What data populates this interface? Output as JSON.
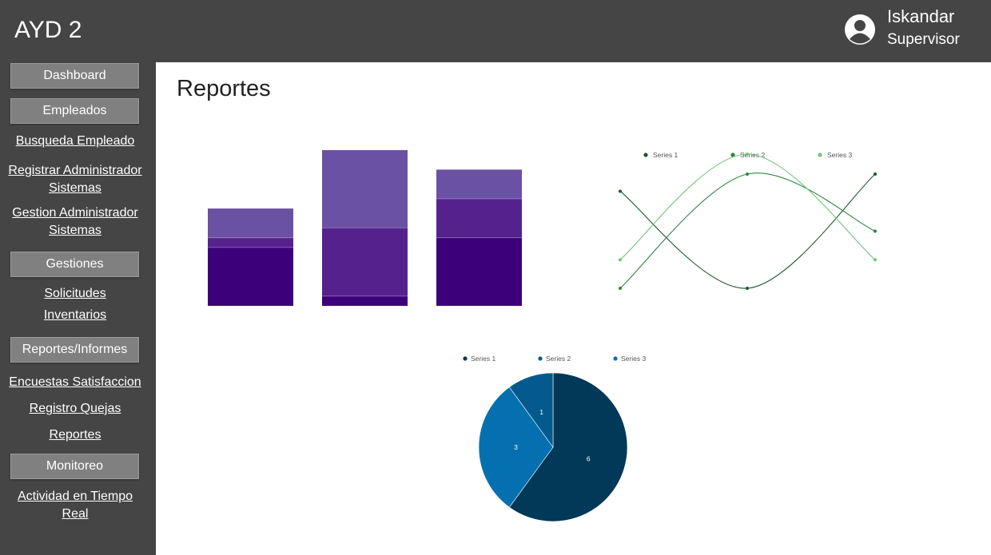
{
  "header": {
    "title": "AYD 2",
    "user_name": "Iskandar",
    "user_role": "Supervisor"
  },
  "sidebar": {
    "dashboard": "Dashboard",
    "empleados": "Empleados",
    "busqueda_empleado": "Busqueda Empleado",
    "registrar_admin_1": "Registrar Administrador",
    "registrar_admin_2": "Sistemas",
    "gestion_admin_1": "Gestion Administrador",
    "gestion_admin_2": "Sistemas",
    "gestiones": "Gestiones",
    "solicitudes": "Solicitudes",
    "inventarios": "Inventarios",
    "reportes_informes": "Reportes/Informes",
    "encuestas": "Encuestas Satisfaccion",
    "registro_quejas": "Registro Quejas",
    "reportes": "Reportes",
    "monitoreo": "Monitoreo",
    "actividad_1": "Actividad en Tiempo",
    "actividad_2": "Real"
  },
  "main": {
    "title": "Reportes"
  },
  "colors": {
    "header_bg": "#454545",
    "sidebar_btn": "#808080",
    "bar_series": [
      "#3d007b",
      "#55228d",
      "#6a51a3"
    ],
    "line_series": [
      "#1e5631",
      "#2e8540",
      "#74c476"
    ],
    "pie_series": [
      "#023858",
      "#045a8d",
      "#0570b0"
    ]
  },
  "chart_data": [
    {
      "type": "bar",
      "stacked": true,
      "categories": [
        "",
        "",
        ""
      ],
      "series": [
        {
          "values": [
            6,
            1,
            7
          ]
        },
        {
          "values": [
            1,
            7,
            4
          ]
        },
        {
          "values": [
            3,
            8,
            3
          ]
        }
      ],
      "ylim": [
        0,
        16
      ],
      "grid": false
    },
    {
      "type": "line",
      "curve": "smooth",
      "x": [
        1,
        2,
        3
      ],
      "series": [
        {
          "name": "Series 1",
          "values": [
            3.4,
            0,
            4
          ]
        },
        {
          "name": "Series 2",
          "values": [
            0,
            4,
            2
          ]
        },
        {
          "name": "Series 3",
          "values": [
            1,
            4.7,
            1
          ]
        }
      ],
      "ylim": [
        0,
        4.7
      ],
      "legend": "top",
      "grid": false
    },
    {
      "type": "pie",
      "labels": [
        "Series 1",
        "Series 2",
        "Series 3"
      ],
      "values": [
        6,
        1,
        3
      ],
      "data_labels": [
        "6",
        "1",
        "3"
      ],
      "legend": "top"
    }
  ]
}
